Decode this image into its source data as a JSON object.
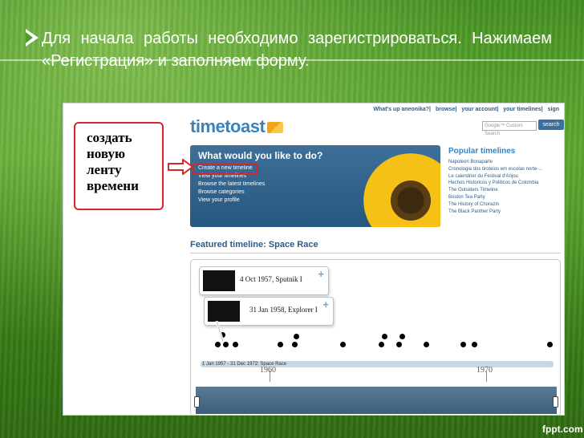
{
  "slide": {
    "text_line1": "Для начала работы необходимо зарегистрироваться. Нажимаем",
    "text_line2": "«Регистрация» и заполняем форму.",
    "footer": "fppt.com"
  },
  "annotation": {
    "text": "создать новую ленту времени",
    "line1": "создать",
    "line2": "новую",
    "line3": "ленту",
    "line4": "времени"
  },
  "site": {
    "logo": "timetoast",
    "top_links": [
      "What's up aneonika?",
      "browse",
      "your account",
      "your timelines",
      "sign"
    ],
    "search_placeholder": "Google™ Custom Search",
    "search_button": "search",
    "hero_title": "What would you like to do?",
    "hero_links": [
      "Create a new timeline",
      "View your timelines",
      "Browse the latest timelines",
      "Browse categories",
      "View your profile"
    ],
    "popular_title": "Popular timelines",
    "popular_items": [
      "Napoleon Bonaparte",
      "Cronologia dos tiroteios em escolas norte-...",
      "Le calendrier du Festival d'Anjou",
      "Hechos Historicos y Politicos de Colombia",
      "The Outsiders Timeline",
      "Boston Tea Party",
      "The History of Chorazin",
      "The Black Panther Party"
    ],
    "featured_title": "Featured timeline: Space Race",
    "timeline": {
      "card1": "4 Oct 1957, Sputnik I",
      "card2": "31 Jan 1958, Explorer I",
      "range_label": "1 Jan 1957 - 31 Dec 1972: Space Race",
      "years": [
        "1960",
        "1970"
      ]
    }
  },
  "colors": {
    "accent_red": "#d8252b",
    "site_blue": "#3a82b9"
  }
}
